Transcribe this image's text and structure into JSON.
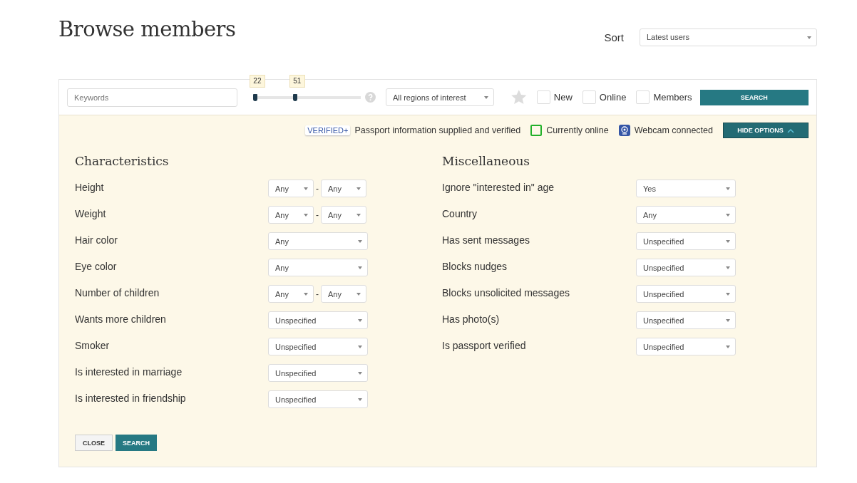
{
  "page": {
    "title": "Browse members"
  },
  "sort": {
    "label": "Sort",
    "value": "Latest users"
  },
  "search_bar": {
    "keywords_placeholder": "Keywords",
    "age_range": {
      "handles": [
        {
          "label": "22",
          "level": 0
        },
        {
          "label": "51",
          "level": 0.37
        }
      ]
    },
    "region": "All regions of interest",
    "favorite_selected": false,
    "filters": [
      {
        "label": "New",
        "checked": false
      },
      {
        "label": "Online",
        "checked": false
      },
      {
        "label": "Members",
        "checked": false
      }
    ],
    "search_button": "SEARCH"
  },
  "legend": [
    {
      "kind": "badge",
      "badge": "VERIFIED+",
      "label": "Passport information supplied and verified"
    },
    {
      "kind": "online",
      "label": "Currently online"
    },
    {
      "kind": "webcam",
      "label": "Webcam connected"
    }
  ],
  "hide_options_button": "HIDE OPTIONS",
  "sections": [
    {
      "title": "Characteristics",
      "rows": [
        {
          "kind": "range",
          "label": "Height",
          "from": "Any",
          "separator": "-",
          "to": "Any"
        },
        {
          "kind": "range",
          "label": "Weight",
          "from": "Any",
          "separator": "-",
          "to": "Any"
        },
        {
          "kind": "select",
          "label": "Hair color",
          "value": "Any"
        },
        {
          "kind": "select",
          "label": "Eye color",
          "value": "Any"
        },
        {
          "kind": "range",
          "label": "Number of children",
          "from": "Any",
          "separator": "-",
          "to": "Any"
        },
        {
          "kind": "select",
          "label": "Wants more children",
          "value": "Unspecified"
        },
        {
          "kind": "select",
          "label": "Smoker",
          "value": "Unspecified"
        },
        {
          "kind": "select",
          "label": "Is interested in marriage",
          "value": "Unspecified"
        },
        {
          "kind": "select",
          "label": "Is interested in friendship",
          "value": "Unspecified"
        }
      ]
    },
    {
      "title": "Miscellaneous",
      "rows": [
        {
          "kind": "select",
          "label": "Ignore \"interested in\" age",
          "value": "Yes"
        },
        {
          "kind": "select",
          "label": "Country",
          "value": "Any"
        },
        {
          "kind": "select",
          "label": "Has sent messages",
          "value": "Unspecified"
        },
        {
          "kind": "select",
          "label": "Blocks nudges",
          "value": "Unspecified"
        },
        {
          "kind": "select",
          "label": "Blocks unsolicited messages",
          "value": "Unspecified"
        },
        {
          "kind": "select",
          "label": "Has photo(s)",
          "value": "Unspecified"
        },
        {
          "kind": "select",
          "label": "Is passport verified",
          "value": "Unspecified"
        }
      ]
    }
  ],
  "footer_buttons": [
    {
      "kind": "secondary",
      "label": "CLOSE"
    },
    {
      "kind": "primary",
      "label": "SEARCH"
    }
  ]
}
